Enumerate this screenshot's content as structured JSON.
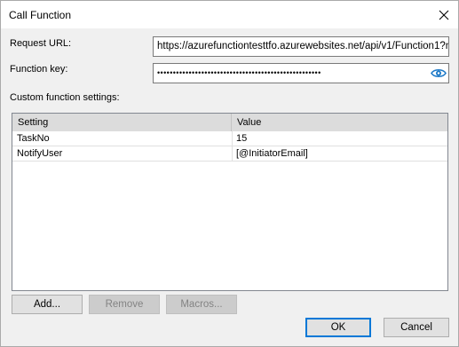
{
  "window": {
    "title": "Call Function"
  },
  "form": {
    "request_url_label": "Request URL:",
    "request_url_value": "https://azurefunctiontesttfo.azurewebsites.net/api/v1/Function1?n",
    "function_key_label": "Function key:",
    "function_key_value": "••••••••••••••••••••••••••••••••••••••••••••••••••••",
    "custom_settings_label": "Custom function settings:"
  },
  "grid": {
    "columns": [
      "Setting",
      "Value"
    ],
    "rows": [
      {
        "setting": "TaskNo",
        "value": "15"
      },
      {
        "setting": "NotifyUser",
        "value": "[@InitiatorEmail]"
      }
    ]
  },
  "buttons": {
    "add": "Add...",
    "remove": "Remove",
    "macros": "Macros...",
    "ok": "OK",
    "cancel": "Cancel"
  },
  "icons": {
    "close": "close-icon",
    "show_password": "eye-icon"
  },
  "colors": {
    "accent": "#0078d7",
    "dialog_background": "#f0f0f0",
    "grid_header": "#dcdcdc"
  }
}
